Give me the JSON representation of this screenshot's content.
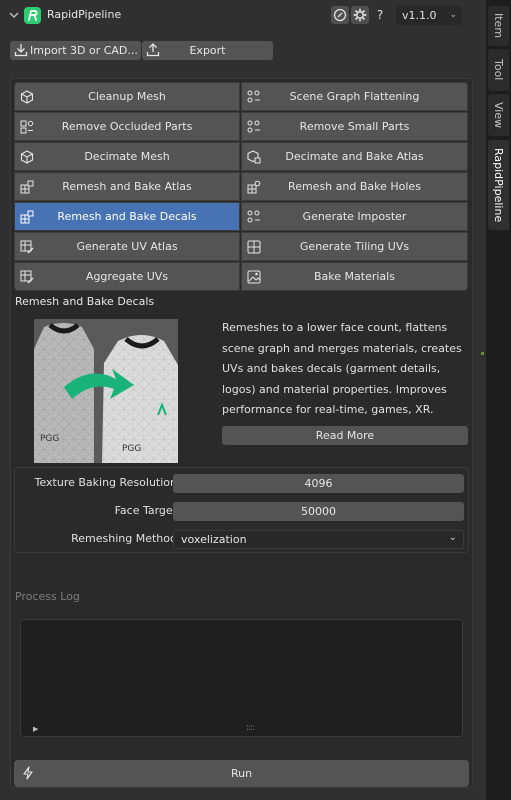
{
  "header": {
    "title": "RapidPipeline",
    "version": "v1.1.0",
    "icons": [
      "help-circle-icon",
      "gear-icon",
      "question-icon"
    ]
  },
  "toolbar": {
    "import_label": "Import 3D or CAD...",
    "export_label": "Export"
  },
  "operations": [
    {
      "label": "Cleanup Mesh",
      "icon": "cleanup-mesh-icon"
    },
    {
      "label": "Scene Graph Flattening",
      "icon": "scene-graph-icon"
    },
    {
      "label": "Remove Occluded Parts",
      "icon": "occluded-parts-icon"
    },
    {
      "label": "Remove Small Parts",
      "icon": "small-parts-icon"
    },
    {
      "label": "Decimate Mesh",
      "icon": "decimate-icon"
    },
    {
      "label": "Decimate and Bake Atlas",
      "icon": "decimate-atlas-icon"
    },
    {
      "label": "Remesh and Bake Atlas",
      "icon": "remesh-atlas-icon"
    },
    {
      "label": "Remesh and Bake Holes",
      "icon": "remesh-holes-icon"
    },
    {
      "label": "Remesh and Bake Decals",
      "icon": "remesh-decals-icon",
      "active": true
    },
    {
      "label": "Generate Imposter",
      "icon": "imposter-icon"
    },
    {
      "label": "Generate UV Atlas",
      "icon": "uv-atlas-icon"
    },
    {
      "label": "Generate Tiling UVs",
      "icon": "tiling-uv-icon"
    },
    {
      "label": "Aggregate UVs",
      "icon": "aggregate-uv-icon"
    },
    {
      "label": "Bake Materials",
      "icon": "bake-materials-icon"
    }
  ],
  "selected": {
    "title": "Remesh and Bake Decals",
    "description": "Remeshes to a lower face count, flattens scene graph and merges materials, creates UVs and bakes decals (garment details, logos) and material properties. Improves performance for real-time, games, XR.",
    "read_more": "Read More",
    "preview_labels": [
      "PGG",
      "PGG"
    ]
  },
  "params": {
    "texture_label": "Texture Baking Resolution",
    "texture_value": "4096",
    "face_label": "Face Target",
    "face_value": "50000",
    "method_label": "Remeshing Method",
    "method_value": "voxelization"
  },
  "log": {
    "label": "Process Log",
    "expand_icon": "▶",
    "grip": "::::"
  },
  "run_label": "Run",
  "side_tabs": {
    "item": "Item",
    "tool": "Tool",
    "view": "View",
    "rapid": "RapidPipeline"
  },
  "colors": {
    "accent": "#4772b3",
    "logo": "#2ecc71",
    "button": "#545454",
    "panel": "#303030"
  }
}
